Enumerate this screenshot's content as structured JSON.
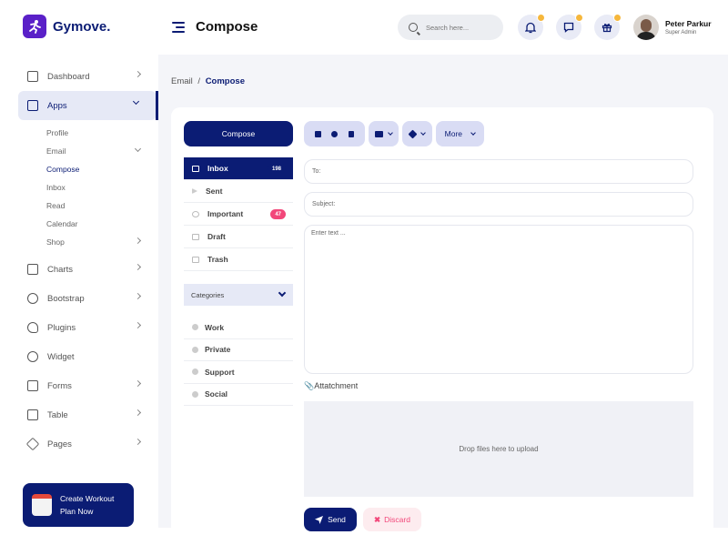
{
  "app": {
    "name": "Gymove."
  },
  "sidebar": {
    "items": [
      {
        "label": "Dashboard",
        "icon": "dashboard-icon"
      },
      {
        "label": "Apps",
        "icon": "monitor-icon"
      },
      {
        "label": "Charts",
        "icon": "sliders-icon"
      },
      {
        "label": "Bootstrap",
        "icon": "globe-icon"
      },
      {
        "label": "Plugins",
        "icon": "heart-icon"
      },
      {
        "label": "Widget",
        "icon": "gear-icon"
      },
      {
        "label": "Forms",
        "icon": "forms-icon"
      },
      {
        "label": "Table",
        "icon": "table-icon"
      },
      {
        "label": "Pages",
        "icon": "layers-icon"
      }
    ],
    "apps_sub": [
      "Profile",
      "Email",
      "Compose",
      "Inbox",
      "Read",
      "Calendar",
      "Shop"
    ]
  },
  "promo": {
    "line1": "Create Workout",
    "line2": "Plan Now"
  },
  "header": {
    "title": "Compose",
    "search_placeholder": "Search here...",
    "user_name": "Peter Parkur",
    "user_role": "Super Admin"
  },
  "breadcrumb": {
    "parent": "Email",
    "separator": "/",
    "current": "Compose"
  },
  "mail": {
    "compose_label": "Compose",
    "folders": [
      {
        "label": "Inbox",
        "badge": "198"
      },
      {
        "label": "Sent"
      },
      {
        "label": "Important",
        "badge": "47"
      },
      {
        "label": "Draft"
      },
      {
        "label": "Trash"
      }
    ],
    "categories_label": "Categories",
    "categories": [
      "Work",
      "Private",
      "Support",
      "Social"
    ]
  },
  "toolbar": {
    "more_label": "More"
  },
  "form": {
    "to_placeholder": "To:",
    "subject_placeholder": "Subject:",
    "body_placeholder": "Enter text ...",
    "attachment_label": "Attatchment",
    "drop_text": "Drop files here to upload",
    "send_label": "Send",
    "discard_label": "Discard"
  },
  "colors": {
    "primary": "#0b1c74",
    "accent": "#5a20c8",
    "notification": "#f6b73c",
    "danger": "#f2477a"
  }
}
